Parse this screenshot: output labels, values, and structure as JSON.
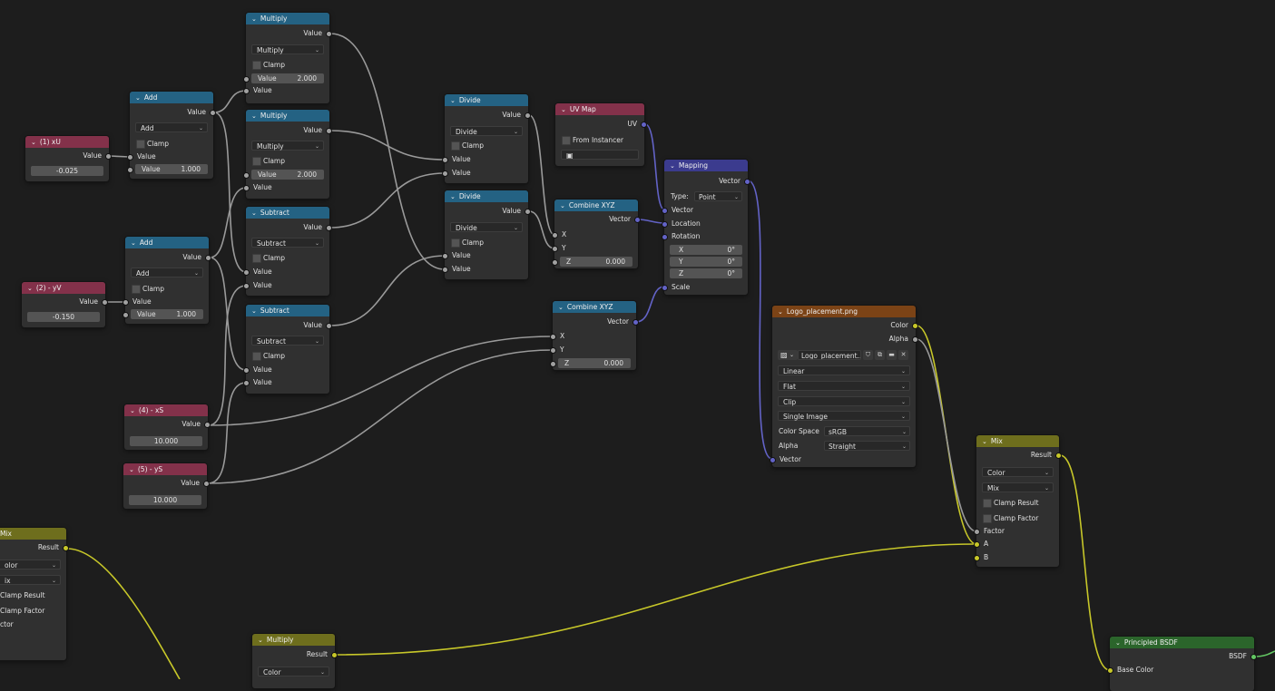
{
  "labels": {
    "value": "Value",
    "clamp": "Clamp",
    "clamp_result": "Clamp Result",
    "clamp_factor": "Clamp Factor",
    "factor": "Factor",
    "a": "A",
    "b": "B",
    "result": "Result",
    "x": "X",
    "y": "Y",
    "z": "Z",
    "vector": "Vector"
  },
  "nodes": {
    "xu": {
      "title": "(1) xU",
      "value": "-0.025"
    },
    "yv": {
      "title": "(2) - yV",
      "value": "-0.150"
    },
    "xs": {
      "title": "(4) - xS",
      "value": "10.000"
    },
    "ys": {
      "title": "(5) - yS",
      "value": "10.000"
    },
    "add1": {
      "title": "Add",
      "op": "Add",
      "value": "1.000"
    },
    "add2": {
      "title": "Add",
      "op": "Add",
      "value": "1.000"
    },
    "mul1": {
      "title": "Multiply",
      "op": "Multiply",
      "value": "2.000"
    },
    "mul2": {
      "title": "Multiply",
      "op": "Multiply",
      "value": "2.000"
    },
    "sub1": {
      "title": "Subtract",
      "op": "Subtract"
    },
    "sub2": {
      "title": "Subtract",
      "op": "Subtract"
    },
    "div1": {
      "title": "Divide",
      "op": "Divide"
    },
    "div2": {
      "title": "Divide",
      "op": "Divide"
    },
    "uvmap": {
      "title": "UV Map",
      "output": "UV",
      "from_instancer": "From Instancer"
    },
    "comb1": {
      "title": "Combine XYZ",
      "z": "0.000"
    },
    "comb2": {
      "title": "Combine XYZ",
      "z": "0.000"
    },
    "mapping": {
      "title": "Mapping",
      "type_label": "Type:",
      "type_value": "Point",
      "location": "Location",
      "rotation": "Rotation",
      "scale": "Scale",
      "rx": "0°",
      "ry": "0°",
      "rz": "0°"
    },
    "image": {
      "title": "Logo_placement.png",
      "color": "Color",
      "alpha": "Alpha",
      "image_name": "Logo_placement....",
      "interpolation": "Linear",
      "projection": "Flat",
      "extension": "Clip",
      "source": "Single Image",
      "color_space_label": "Color Space",
      "color_space": "sRGB",
      "alpha_label": "Alpha",
      "alpha_mode": "Straight"
    },
    "mix": {
      "title": "Mix",
      "data_type": "Color",
      "blend": "Mix"
    },
    "mix_left": {
      "title": "Mix",
      "data_type": "olor",
      "blend": "ix",
      "clamp_result": "Clamp Result",
      "clamp_factor": "Clamp Factor",
      "factor": "ctor"
    },
    "mul_bottom": {
      "title": "Multiply",
      "data_type": "Color"
    },
    "bsdf": {
      "title": "Principled BSDF",
      "output": "BSDF",
      "base_color": "Base Color"
    }
  },
  "colors": {
    "background": "#1d1d1d",
    "node_body": "#303030",
    "header_math": "#246283",
    "header_input": "#83314a",
    "header_vector": "#3b3b8e",
    "header_color": "#6e6e1d",
    "header_texture": "#7b4316",
    "header_shader": "#2b652b",
    "socket_float": "#a1a1a1",
    "socket_vector": "#6363c7",
    "socket_color": "#c7c729",
    "socket_shader": "#63c763"
  }
}
